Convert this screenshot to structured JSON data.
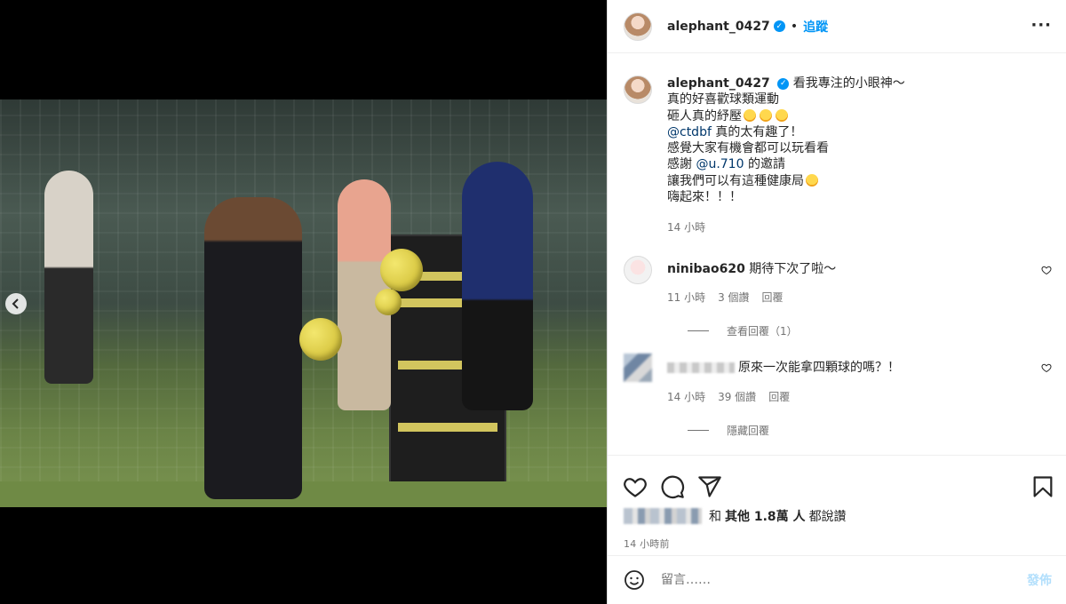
{
  "header": {
    "username": "alephant_0427",
    "separator": "•",
    "follow_label": "追蹤",
    "more_label": "···"
  },
  "caption": {
    "username": "alephant_0427",
    "lines": [
      "看我專注的小眼神～",
      "真的好喜歡球類運動",
      "砸人真的紓壓",
      "真的太有趣了！",
      "感覺大家有機會都可以玩看看",
      "的邀請",
      "讓我們可以有這種健康局",
      "嗨起來！！！"
    ],
    "mention1": "@ctdbf",
    "thanks_prefix": "感謝",
    "mention2": "@u.710",
    "time": "14 小時"
  },
  "comments": [
    {
      "username": "ninibao620",
      "text": "期待下次了啦～",
      "time": "11 小時",
      "likes": "3 個讚",
      "reply_label": "回覆",
      "replies_toggle": "查看回覆（1）"
    },
    {
      "username": "",
      "text": "原來一次能拿四顆球的嗎？！",
      "time": "14 小時",
      "likes": "39 個讚",
      "reply_label": "回覆",
      "replies_toggle": "隱藏回覆"
    }
  ],
  "likes": {
    "prefix": "和",
    "bold": "其他 1.8萬 人",
    "suffix": "都說讚"
  },
  "post_time": "14 小時前",
  "add_comment": {
    "placeholder": "留言……",
    "post_label": "發佈"
  },
  "carousel": {
    "count": 2,
    "active_index": 1,
    "prev_icon": "chevron-left-icon"
  },
  "colors": {
    "accent": "#0095f6",
    "mention": "#00376b",
    "muted": "#737373"
  }
}
